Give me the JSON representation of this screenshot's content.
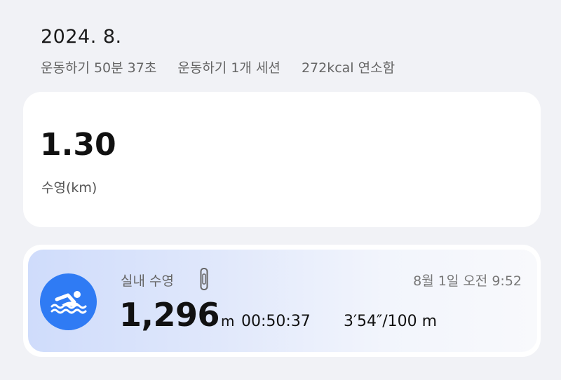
{
  "header": {
    "month": "2024. 8.",
    "summary": {
      "duration": "운동하기 50분 37초",
      "sessions": "운동하기 1개 세션",
      "calories": "272kcal 연소함"
    }
  },
  "distance_card": {
    "value": "1.30",
    "label": "수영(km)"
  },
  "session": {
    "activity": "실내 수영",
    "timestamp": "8월 1일 오전 9:52",
    "distance_value": "1,296",
    "distance_unit": "m",
    "duration": "00:50:37",
    "pace": "3′54″/100 m",
    "icons": {
      "activity": "swimming-icon",
      "device": "watch-icon"
    },
    "colors": {
      "icon_background": "#2f7bf4",
      "card_gradient_start": "#cfdcfb",
      "card_gradient_end": "#f8f9fc"
    }
  }
}
